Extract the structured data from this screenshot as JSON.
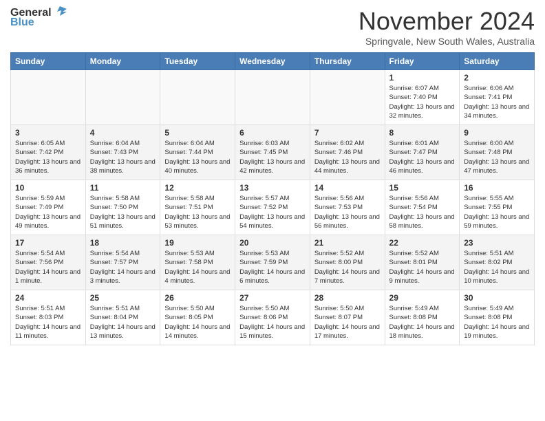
{
  "header": {
    "logo_line1": "General",
    "logo_line2": "Blue",
    "month": "November 2024",
    "location": "Springvale, New South Wales, Australia"
  },
  "weekdays": [
    "Sunday",
    "Monday",
    "Tuesday",
    "Wednesday",
    "Thursday",
    "Friday",
    "Saturday"
  ],
  "weeks": [
    [
      {
        "day": "",
        "empty": true
      },
      {
        "day": "",
        "empty": true
      },
      {
        "day": "",
        "empty": true
      },
      {
        "day": "",
        "empty": true
      },
      {
        "day": "",
        "empty": true
      },
      {
        "day": "1",
        "sunrise": "6:07 AM",
        "sunset": "7:40 PM",
        "daylight": "13 hours and 32 minutes."
      },
      {
        "day": "2",
        "sunrise": "6:06 AM",
        "sunset": "7:41 PM",
        "daylight": "13 hours and 34 minutes."
      }
    ],
    [
      {
        "day": "3",
        "sunrise": "6:05 AM",
        "sunset": "7:42 PM",
        "daylight": "13 hours and 36 minutes."
      },
      {
        "day": "4",
        "sunrise": "6:04 AM",
        "sunset": "7:43 PM",
        "daylight": "13 hours and 38 minutes."
      },
      {
        "day": "5",
        "sunrise": "6:04 AM",
        "sunset": "7:44 PM",
        "daylight": "13 hours and 40 minutes."
      },
      {
        "day": "6",
        "sunrise": "6:03 AM",
        "sunset": "7:45 PM",
        "daylight": "13 hours and 42 minutes."
      },
      {
        "day": "7",
        "sunrise": "6:02 AM",
        "sunset": "7:46 PM",
        "daylight": "13 hours and 44 minutes."
      },
      {
        "day": "8",
        "sunrise": "6:01 AM",
        "sunset": "7:47 PM",
        "daylight": "13 hours and 46 minutes."
      },
      {
        "day": "9",
        "sunrise": "6:00 AM",
        "sunset": "7:48 PM",
        "daylight": "13 hours and 47 minutes."
      }
    ],
    [
      {
        "day": "10",
        "sunrise": "5:59 AM",
        "sunset": "7:49 PM",
        "daylight": "13 hours and 49 minutes."
      },
      {
        "day": "11",
        "sunrise": "5:58 AM",
        "sunset": "7:50 PM",
        "daylight": "13 hours and 51 minutes."
      },
      {
        "day": "12",
        "sunrise": "5:58 AM",
        "sunset": "7:51 PM",
        "daylight": "13 hours and 53 minutes."
      },
      {
        "day": "13",
        "sunrise": "5:57 AM",
        "sunset": "7:52 PM",
        "daylight": "13 hours and 54 minutes."
      },
      {
        "day": "14",
        "sunrise": "5:56 AM",
        "sunset": "7:53 PM",
        "daylight": "13 hours and 56 minutes."
      },
      {
        "day": "15",
        "sunrise": "5:56 AM",
        "sunset": "7:54 PM",
        "daylight": "13 hours and 58 minutes."
      },
      {
        "day": "16",
        "sunrise": "5:55 AM",
        "sunset": "7:55 PM",
        "daylight": "13 hours and 59 minutes."
      }
    ],
    [
      {
        "day": "17",
        "sunrise": "5:54 AM",
        "sunset": "7:56 PM",
        "daylight": "14 hours and 1 minute."
      },
      {
        "day": "18",
        "sunrise": "5:54 AM",
        "sunset": "7:57 PM",
        "daylight": "14 hours and 3 minutes."
      },
      {
        "day": "19",
        "sunrise": "5:53 AM",
        "sunset": "7:58 PM",
        "daylight": "14 hours and 4 minutes."
      },
      {
        "day": "20",
        "sunrise": "5:53 AM",
        "sunset": "7:59 PM",
        "daylight": "14 hours and 6 minutes."
      },
      {
        "day": "21",
        "sunrise": "5:52 AM",
        "sunset": "8:00 PM",
        "daylight": "14 hours and 7 minutes."
      },
      {
        "day": "22",
        "sunrise": "5:52 AM",
        "sunset": "8:01 PM",
        "daylight": "14 hours and 9 minutes."
      },
      {
        "day": "23",
        "sunrise": "5:51 AM",
        "sunset": "8:02 PM",
        "daylight": "14 hours and 10 minutes."
      }
    ],
    [
      {
        "day": "24",
        "sunrise": "5:51 AM",
        "sunset": "8:03 PM",
        "daylight": "14 hours and 11 minutes."
      },
      {
        "day": "25",
        "sunrise": "5:51 AM",
        "sunset": "8:04 PM",
        "daylight": "14 hours and 13 minutes."
      },
      {
        "day": "26",
        "sunrise": "5:50 AM",
        "sunset": "8:05 PM",
        "daylight": "14 hours and 14 minutes."
      },
      {
        "day": "27",
        "sunrise": "5:50 AM",
        "sunset": "8:06 PM",
        "daylight": "14 hours and 15 minutes."
      },
      {
        "day": "28",
        "sunrise": "5:50 AM",
        "sunset": "8:07 PM",
        "daylight": "14 hours and 17 minutes."
      },
      {
        "day": "29",
        "sunrise": "5:49 AM",
        "sunset": "8:08 PM",
        "daylight": "14 hours and 18 minutes."
      },
      {
        "day": "30",
        "sunrise": "5:49 AM",
        "sunset": "8:08 PM",
        "daylight": "14 hours and 19 minutes."
      }
    ]
  ]
}
